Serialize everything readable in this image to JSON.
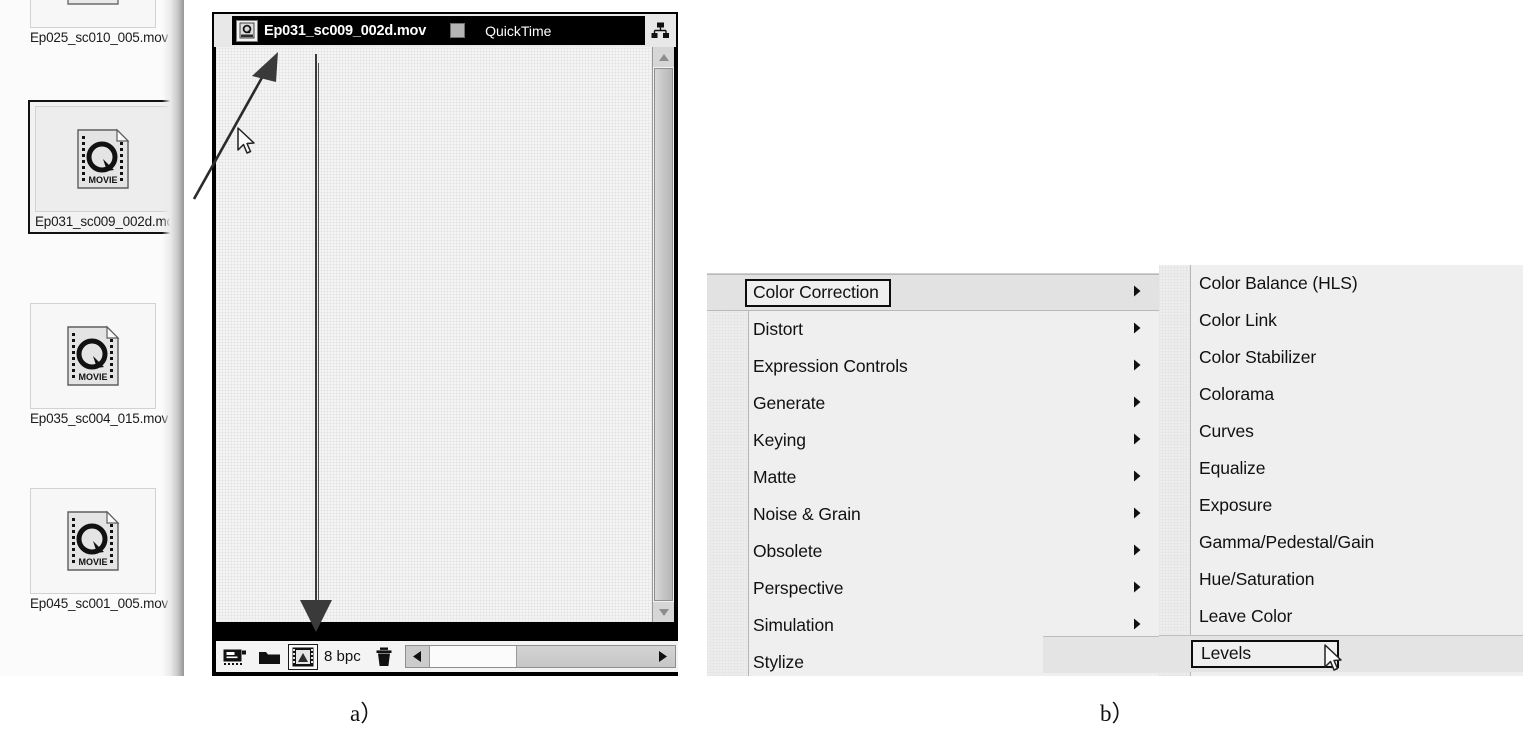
{
  "panel_a": {
    "footage_items": [
      {
        "name": "Ep025_sc010_005.mov",
        "icon": "quicktime-movie-icon",
        "selected": false,
        "partial_top": true
      },
      {
        "name": "Ep031_sc009_002d.mov",
        "icon": "quicktime-movie-icon",
        "selected": true,
        "partial_top": false
      },
      {
        "name": "Ep035_sc004_015.mov",
        "icon": "quicktime-movie-icon",
        "selected": false,
        "partial_top": false
      },
      {
        "name": "Ep045_sc001_005.mov",
        "icon": "quicktime-movie-icon",
        "selected": false,
        "partial_top": false
      }
    ],
    "viewer": {
      "active_tab": {
        "title": "Ep031_sc009_002d.mov",
        "icon": "quicktime-movie-icon"
      },
      "inactive_tab": {
        "label": "QuickTime",
        "icon": "color-swatch-icon"
      },
      "flowchart_button_icon": "flowchart-icon",
      "toolbar": {
        "buttons": [
          {
            "icon": "title-safe-icon",
            "active": false
          },
          {
            "icon": "region-of-interest-icon",
            "active": false
          },
          {
            "icon": "alpha-channel-icon",
            "active": true
          },
          {
            "icon": "trash-icon",
            "active": false
          }
        ],
        "bit_depth_label": "8 bpc",
        "h_scrollbar": {
          "left_arrow_icon": "triangle-left-icon",
          "right_arrow_icon": "triangle-right-icon"
        }
      },
      "v_scrollbar": {
        "up_arrow_icon": "triangle-up-icon",
        "down_arrow_icon": "triangle-down-icon"
      },
      "annotations": {
        "drag_arrow_icon": "drag-direction-arrow",
        "cursor_icon": "mouse-pointer-icon",
        "drop_indicator_icon": "drop-insert-indicator"
      }
    }
  },
  "panel_b": {
    "main_menu": {
      "items": [
        {
          "label": "Color Correction",
          "has_submenu": true,
          "hovered": true
        },
        {
          "label": "Distort",
          "has_submenu": true,
          "hovered": false
        },
        {
          "label": "Expression Controls",
          "has_submenu": true,
          "hovered": false
        },
        {
          "label": "Generate",
          "has_submenu": true,
          "hovered": false
        },
        {
          "label": "Keying",
          "has_submenu": true,
          "hovered": false
        },
        {
          "label": "Matte",
          "has_submenu": true,
          "hovered": false
        },
        {
          "label": "Noise & Grain",
          "has_submenu": true,
          "hovered": false
        },
        {
          "label": "Obsolete",
          "has_submenu": true,
          "hovered": false
        },
        {
          "label": "Perspective",
          "has_submenu": true,
          "hovered": false
        },
        {
          "label": "Simulation",
          "has_submenu": true,
          "hovered": false
        },
        {
          "label": "Stylize",
          "has_submenu": true,
          "hovered": false
        }
      ],
      "submenu_arrow_icon": "triangle-right-icon"
    },
    "submenu": {
      "items": [
        {
          "label": "Color Balance (HLS)",
          "hovered": false
        },
        {
          "label": "Color Link",
          "hovered": false
        },
        {
          "label": "Color Stabilizer",
          "hovered": false
        },
        {
          "label": "Colorama",
          "hovered": false
        },
        {
          "label": "Curves",
          "hovered": false
        },
        {
          "label": "Equalize",
          "hovered": false
        },
        {
          "label": "Exposure",
          "hovered": false
        },
        {
          "label": "Gamma/Pedestal/Gain",
          "hovered": false
        },
        {
          "label": "Hue/Saturation",
          "hovered": false
        },
        {
          "label": "Leave Color",
          "hovered": false
        },
        {
          "label": "Levels",
          "hovered": true
        }
      ],
      "cursor_icon": "mouse-pointer-icon"
    }
  },
  "captions": {
    "a": "a）",
    "b": "b）"
  },
  "colors": {
    "menu_background": "#efefef",
    "menu_hover": "#e2e2e2",
    "titlebar_active": "#000000",
    "titlebar_text": "#ffffff",
    "panel_background": "#fbfbfb",
    "selection_outline": "#0d0d0d"
  }
}
